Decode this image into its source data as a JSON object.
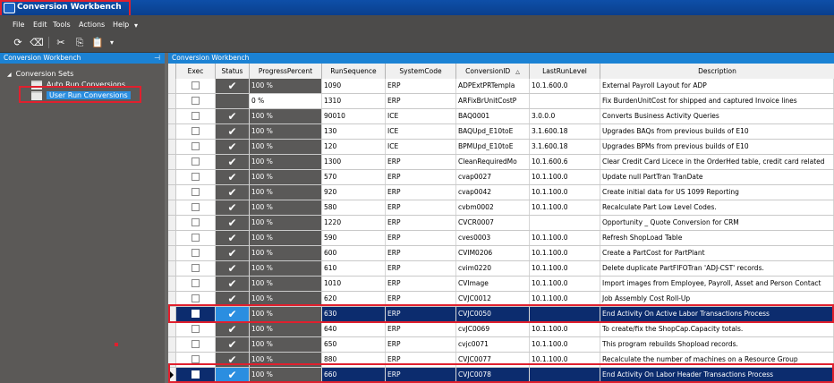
{
  "window": {
    "title": "Conversion Workbench"
  },
  "menu": [
    "File",
    "Edit",
    "Tools",
    "Actions",
    "Help"
  ],
  "toolbar": {
    "icons": [
      "refresh-icon",
      "clear-icon",
      "cut-icon",
      "copy-icon",
      "paste-icon"
    ]
  },
  "left_panel": {
    "title": "Conversion Workbench",
    "tree": {
      "root": "Conversion Sets",
      "children": [
        "Auto Run Conversions",
        "User Run Conversions"
      ],
      "selected": "User Run Conversions"
    }
  },
  "right_panel": {
    "title": "Conversion Workbench"
  },
  "grid": {
    "columns": [
      "Exec",
      "Status",
      "ProgressPercent",
      "RunSequence",
      "SystemCode",
      "ConversionID",
      "LastRunLevel",
      "Description"
    ],
    "sorted_column": "ConversionID",
    "rows": [
      {
        "status": "✔",
        "progress": "100 %",
        "seq": "1090",
        "sys": "ERP",
        "id": "ADPExtPRTempla",
        "level": "10.1.600.0",
        "desc": "External Payroll Layout for ADP"
      },
      {
        "status": "",
        "progress": "0 %",
        "seq": "1310",
        "sys": "ERP",
        "id": "ARFixBrUnitCostP",
        "level": "",
        "desc": "Fix BurdenUnitCost for shipped and captured Invoice lines"
      },
      {
        "status": "✔",
        "progress": "100 %",
        "seq": "90010",
        "sys": "ICE",
        "id": "BAQ0001",
        "level": "3.0.0.0",
        "desc": "Converts Business Activity Queries"
      },
      {
        "status": "✔",
        "progress": "100 %",
        "seq": "130",
        "sys": "ICE",
        "id": "BAQUpd_E10toE",
        "level": "3.1.600.18",
        "desc": "Upgrades BAQs from previous builds of E10"
      },
      {
        "status": "✔",
        "progress": "100 %",
        "seq": "120",
        "sys": "ICE",
        "id": "BPMUpd_E10toE",
        "level": "3.1.600.18",
        "desc": "Upgrades BPMs from previous builds of E10"
      },
      {
        "status": "✔",
        "progress": "100 %",
        "seq": "1300",
        "sys": "ERP",
        "id": "CleanRequiredMo",
        "level": "10.1.600.6",
        "desc": "Clear Credit Card Licece in the OrderHed table, credit card related"
      },
      {
        "status": "✔",
        "progress": "100 %",
        "seq": "570",
        "sys": "ERP",
        "id": "cvap0027",
        "level": "10.1.100.0",
        "desc": "Update null PartTran TranDate"
      },
      {
        "status": "✔",
        "progress": "100 %",
        "seq": "920",
        "sys": "ERP",
        "id": "cvap0042",
        "level": "10.1.100.0",
        "desc": "Create initial data for US 1099 Reporting"
      },
      {
        "status": "✔",
        "progress": "100 %",
        "seq": "580",
        "sys": "ERP",
        "id": "cvbm0002",
        "level": "10.1.100.0",
        "desc": "Recalculate Part Low Level Codes."
      },
      {
        "status": "✔",
        "progress": "100 %",
        "seq": "1220",
        "sys": "ERP",
        "id": "CVCR0007",
        "level": "",
        "desc": "Opportunity _ Quote Conversion for CRM"
      },
      {
        "status": "✔",
        "progress": "100 %",
        "seq": "590",
        "sys": "ERP",
        "id": "cves0003",
        "level": "10.1.100.0",
        "desc": "Refresh ShopLoad Table"
      },
      {
        "status": "✔",
        "progress": "100 %",
        "seq": "600",
        "sys": "ERP",
        "id": "CVIM0206",
        "level": "10.1.100.0",
        "desc": "Create a PartCost for PartPlant"
      },
      {
        "status": "✔",
        "progress": "100 %",
        "seq": "610",
        "sys": "ERP",
        "id": "cvim0220",
        "level": "10.1.100.0",
        "desc": "Delete duplicate PartFIFOTran 'ADJ-CST' records."
      },
      {
        "status": "✔",
        "progress": "100 %",
        "seq": "1010",
        "sys": "ERP",
        "id": "CVImage",
        "level": "10.1.100.0",
        "desc": "Import images from Employee, Payroll, Asset and Person Contact"
      },
      {
        "status": "✔",
        "progress": "100 %",
        "seq": "620",
        "sys": "ERP",
        "id": "CVJC0012",
        "level": "10.1.100.0",
        "desc": "Job Assembly Cost Roll-Up"
      },
      {
        "status": "✔",
        "progress": "100 %",
        "seq": "630",
        "sys": "ERP",
        "id": "CVJC0050",
        "level": "",
        "desc": "End Activity On Active Labor Transactions Process",
        "selected": true
      },
      {
        "status": "✔",
        "progress": "100 %",
        "seq": "640",
        "sys": "ERP",
        "id": "cvJC0069",
        "level": "10.1.100.0",
        "desc": "To create/fix the ShopCap.Capacity totals."
      },
      {
        "status": "✔",
        "progress": "100 %",
        "seq": "650",
        "sys": "ERP",
        "id": "cvjc0071",
        "level": "10.1.100.0",
        "desc": "This program rebuilds Shopload records."
      },
      {
        "status": "✔",
        "progress": "100 %",
        "seq": "880",
        "sys": "ERP",
        "id": "CVJC0077",
        "level": "10.1.100.0",
        "desc": "Recalculate the number of machines on a Resource Group"
      },
      {
        "status": "✔",
        "progress": "100 %",
        "seq": "660",
        "sys": "ERP",
        "id": "CVJC0078",
        "level": "",
        "desc": "End Activity On Labor Header Transactions Process",
        "selected": true,
        "current": true
      }
    ]
  }
}
